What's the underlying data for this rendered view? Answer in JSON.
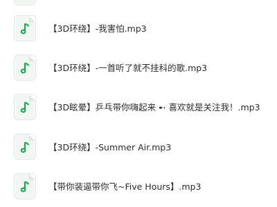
{
  "files": [
    {
      "name": "【3D环绕】-我害怕.mp3",
      "icon": "music-note-icon"
    },
    {
      "name": "【3D环绕】-一首听了就不挂科的歌.mp3",
      "icon": "music-note-icon"
    },
    {
      "name": "【3D眩晕】乒乓带你嗨起来 ➸ 喜欢就是关注我！.mp3",
      "icon": "music-note-icon"
    },
    {
      "name": "【3D环绕】-Summer Air.mp3",
      "icon": "music-note-icon"
    },
    {
      "name": "【带你装逼带你飞~Five Hours】.mp3",
      "icon": "music-note-icon"
    }
  ],
  "colors": {
    "note_green": "#1fa855",
    "icon_bg": "#f2f7f3",
    "text": "#2b2b2b"
  }
}
